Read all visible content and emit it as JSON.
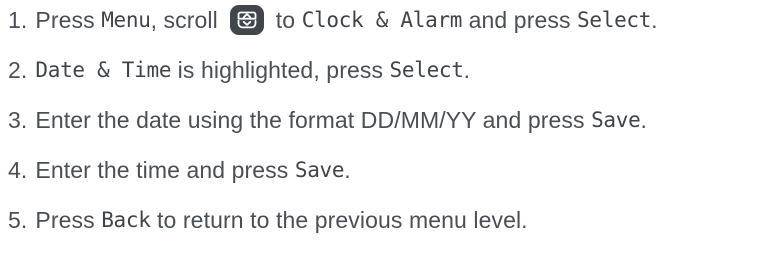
{
  "steps": [
    {
      "number": "1.",
      "parts": {
        "t1": "Press ",
        "k1": "Menu",
        "t2": ", scroll ",
        "icon": "scroll-navigation-key-icon",
        "t3": " to ",
        "k2": "Clock & Alarm",
        "t4": " and press ",
        "k3": "Select",
        "t5": "."
      }
    },
    {
      "number": "2.",
      "parts": {
        "k1": "Date & Time",
        "t1": " is highlighted, press ",
        "k2": "Select",
        "t2": "."
      }
    },
    {
      "number": "3.",
      "parts": {
        "t1": "Enter the date using the format DD/MM/YY and press ",
        "k1": "Save",
        "t2": "."
      }
    },
    {
      "number": "4.",
      "parts": {
        "t1": "Enter the time and press ",
        "k1": "Save",
        "t2": "."
      }
    },
    {
      "number": "5.",
      "parts": {
        "t1": "Press ",
        "k1": "Back",
        "t2": " to return to the previous menu level."
      }
    }
  ]
}
